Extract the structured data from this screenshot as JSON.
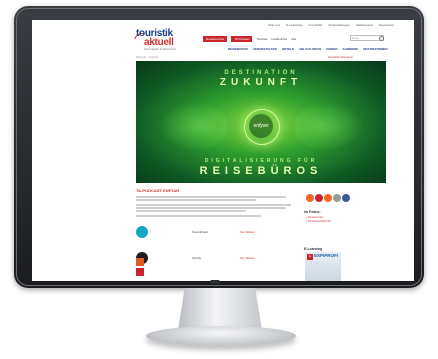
{
  "topbar": {
    "links": [
      "Über uns",
      "E-Learnings",
      "Kreuzfahrt",
      "Veranstaltungen",
      "Stellenportal",
      "Abonnieren"
    ]
  },
  "logo": {
    "line1": "touristik",
    "line2": "aktuell",
    "tagline": "Fachmagazin für Reisebüros"
  },
  "secondary_nav": {
    "red_tabs": [
      "Reiseberichte",
      "TA Podcast"
    ],
    "plain_tabs": [
      "Touristik",
      "Länderinfos",
      "Alle"
    ]
  },
  "search": {
    "placeholder": "Suche"
  },
  "main_nav": [
    "REISEBÜROS",
    "VERANSTALTER",
    "HOTELS",
    "ABLAUF-INFOS",
    "REISEN",
    "KARRIERE",
    "DESTINATIONEN"
  ],
  "breadcrumb": "Startseite » Podcast",
  "breadcrumb_right": "Newsletter abonnieren",
  "hero": {
    "line1": "DESTINATION",
    "line2": "ZUKUNFT",
    "badge": "enfyan",
    "line3": "DIGITALISIERUNG FÜR",
    "line4": "REISEBÜROS"
  },
  "article": {
    "title": "TA-PODCAST ENFYAN",
    "podcasts": [
      {
        "name": "Soundcloud",
        "link": "hier klicken",
        "color": "#17a7c4"
      },
      {
        "name": "Spotify",
        "link": "hier klicken",
        "color": "#1e1e1e"
      }
    ]
  },
  "sidebar": {
    "social_colors": [
      "#f26522",
      "#c8262b",
      "#f26522",
      "#999999",
      "#3b5998"
    ],
    "box1_title": "Im Fokus:",
    "box1_items": [
      "» Reiseberichte",
      "» TA Podcast ENFYAN"
    ],
    "box2_title": "E-Learning",
    "ad_logo": "ta",
    "ad_text": "EXPIPROFI"
  }
}
